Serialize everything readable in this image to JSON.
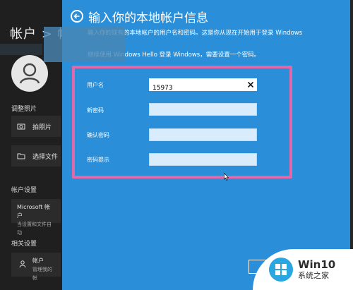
{
  "background": {
    "title": "帐户 > 帐",
    "adjust_photo_label": "调整照片",
    "take_photo": "拍照片",
    "choose_file": "选择文件",
    "account_settings_label": "帐户设置",
    "ms_account": "Microsoft 帐户",
    "ms_account_sub": "当设置和文件自动",
    "related_settings_label": "相关设置",
    "accounts_item": "帐户",
    "accounts_item_sub": "管理我的帐"
  },
  "dialog": {
    "title": "输入你的本地帐户信息",
    "desc_line1": "输入你的现有的本地帐户的用户名和密码。这是你从现在开始用于登录 Windows",
    "desc_line2": "继续使用 Windows Hello 登录 Windows，需要设置一个密码。",
    "fields": {
      "username_label": "用户名",
      "username_value": "15973",
      "new_password_label": "新密码",
      "confirm_password_label": "确认密码",
      "hint_label": "密码提示"
    }
  },
  "watermark": {
    "line1": "Win10",
    "line2": "系统之家"
  },
  "colors": {
    "dialog_blue": "#2a8fd8",
    "highlight_pink": "#e06aa9"
  }
}
